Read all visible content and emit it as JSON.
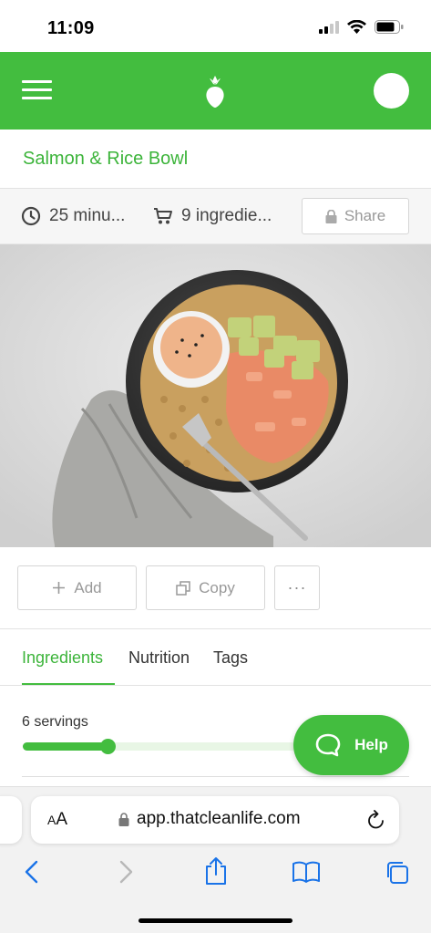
{
  "status_bar": {
    "time": "11:09"
  },
  "header": {
    "menu_icon": "hamburger-menu-icon",
    "logo_icon": "carrot-logo-icon",
    "avatar": "user-avatar"
  },
  "recipe": {
    "title": "Salmon & Rice Bowl",
    "time": "25 minu...",
    "ingredients_count": "9 ingredie...",
    "share_label": "Share"
  },
  "actions": {
    "add_label": "Add",
    "copy_label": "Copy",
    "more_label": "···"
  },
  "tabs": [
    {
      "label": "Ingredients",
      "active": true
    },
    {
      "label": "Nutrition",
      "active": false
    },
    {
      "label": "Tags",
      "active": false
    }
  ],
  "servings": {
    "label": "6 servings",
    "slider_fraction": 0.31
  },
  "help": {
    "label": "Help"
  },
  "browser": {
    "aa_big": "A",
    "aa_small": "A",
    "url": "app.thatcleanlife.com"
  },
  "colors": {
    "brand_green": "#43bd3f",
    "title_green": "#3cb43a",
    "ios_blue": "#1a73e8"
  }
}
